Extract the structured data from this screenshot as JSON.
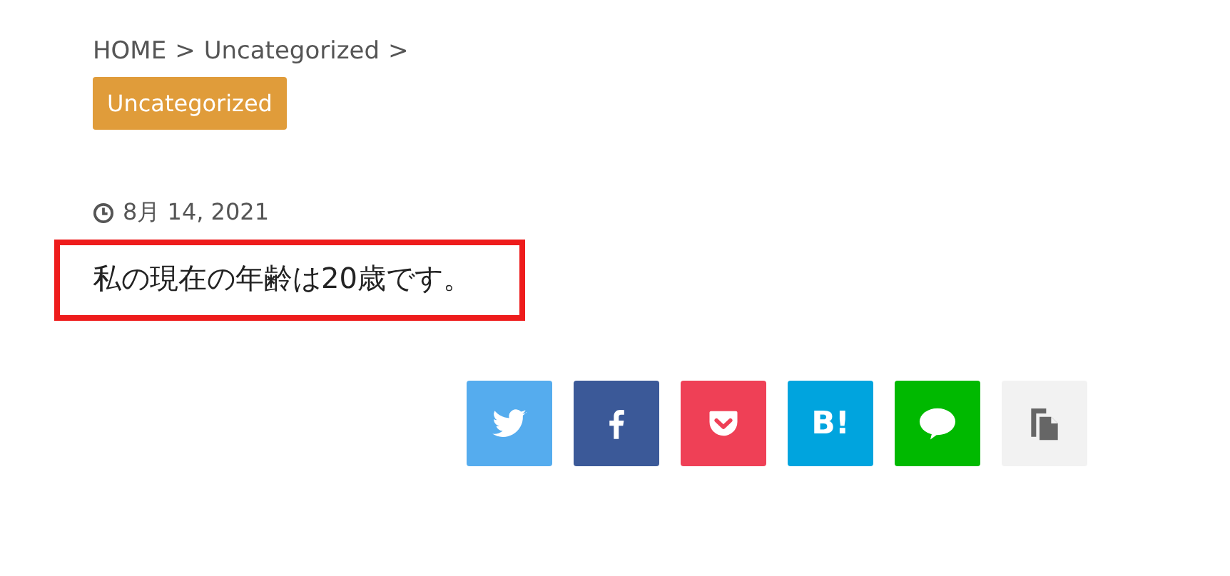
{
  "breadcrumb": [
    {
      "label": "HOME",
      "separator": ">"
    },
    {
      "label": "Uncategorized",
      "separator": ">"
    }
  ],
  "category": "Uncategorized",
  "date": "8月 14, 2021",
  "post": {
    "text": "私の現在の年齢は20歳です。",
    "highlighted": true
  },
  "share_buttons": [
    {
      "kind": "twitter"
    },
    {
      "kind": "facebook"
    },
    {
      "kind": "pocket"
    },
    {
      "kind": "hatena",
      "label": "B!"
    },
    {
      "kind": "line"
    },
    {
      "kind": "copy"
    }
  ]
}
